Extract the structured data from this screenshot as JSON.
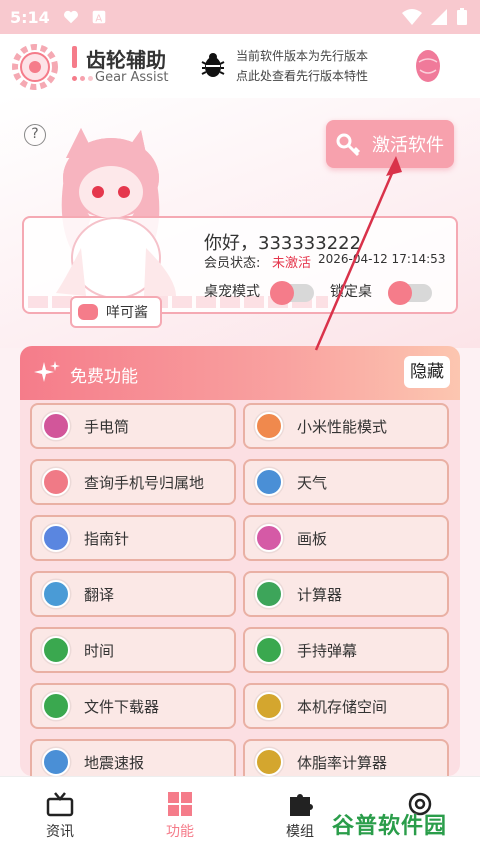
{
  "status_bar": {
    "time": "5:14"
  },
  "header": {
    "app_title": "齿轮辅助",
    "app_subtitle": "Gear Assist",
    "notice_line1": "当前软件版本为先行版本",
    "notice_line2": "点此处查看先行版本特性"
  },
  "hero": {
    "help": "?",
    "activate_label": "激活软件",
    "greeting": "你好，333333222",
    "member_label": "会员状态:",
    "member_status": "未激活",
    "member_date": "2026-04-12 17:14:53",
    "toggle_pet_label": "桌宠模式",
    "toggle_lock_label": "锁定桌",
    "name_tag": "咩可酱"
  },
  "panel": {
    "title": "免费功能",
    "hide_label": "隐藏",
    "items": [
      {
        "label": "手电筒",
        "icon": "flashlight-icon",
        "color": "#d2569a"
      },
      {
        "label": "小米性能模式",
        "icon": "miui-icon",
        "color": "#f0894d"
      },
      {
        "label": "查询手机号归属地",
        "icon": "location-icon",
        "color": "#f07a86"
      },
      {
        "label": "天气",
        "icon": "cloud-icon",
        "color": "#4a8fd6"
      },
      {
        "label": "指南针",
        "icon": "compass-icon",
        "color": "#5a86e0"
      },
      {
        "label": "画板",
        "icon": "palette-icon",
        "color": "#d55aa6"
      },
      {
        "label": "翻译",
        "icon": "translate-icon",
        "color": "#4a9bd6"
      },
      {
        "label": "计算器",
        "icon": "calculator-icon",
        "color": "#3da55a"
      },
      {
        "label": "时间",
        "icon": "clock-icon",
        "color": "#3aa84f"
      },
      {
        "label": "手持弹幕",
        "icon": "danmaku-icon",
        "color": "#3aa84f"
      },
      {
        "label": "文件下载器",
        "icon": "download-icon",
        "color": "#3aa84f"
      },
      {
        "label": "本机存储空间",
        "icon": "storage-icon",
        "color": "#d4a62e"
      },
      {
        "label": "地震速报",
        "icon": "home-icon",
        "color": "#4a8fd6"
      },
      {
        "label": "体脂率计算器",
        "icon": "scale-icon",
        "color": "#d4a62e"
      }
    ]
  },
  "nav": {
    "items": [
      {
        "label": "资讯"
      },
      {
        "label": "功能"
      },
      {
        "label": "模组"
      }
    ]
  },
  "watermark": "谷普软件园",
  "colors": {
    "accent": "#f57c8a",
    "panel_bg": "#fcdfe3",
    "button_border": "#e9b0a4"
  }
}
